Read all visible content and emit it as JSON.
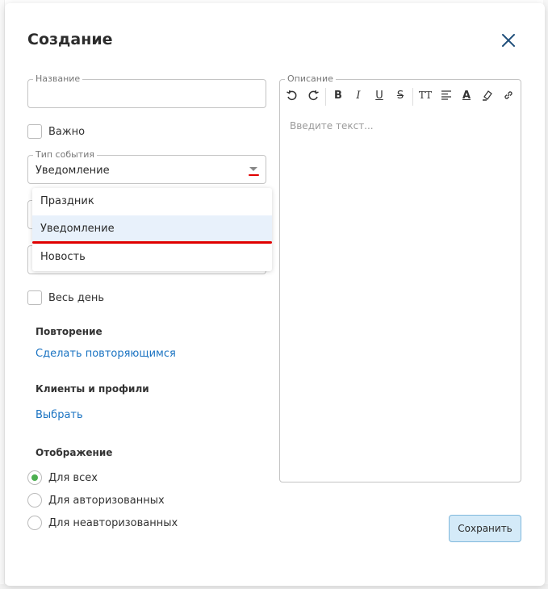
{
  "dialog": {
    "title": "Создание",
    "save_label": "Сохранить"
  },
  "form": {
    "name_legend": "Название",
    "name_value": "",
    "important_label": "Важно",
    "event_type_legend": "Тип события",
    "event_type_value": "Уведомление",
    "event_type_options": [
      "Праздник",
      "Уведомление",
      "Новость"
    ],
    "all_day_label": "Весь день",
    "repeat_title": "Повторение",
    "repeat_link": "Сделать повторяющимся",
    "clients_title": "Клиенты и профили",
    "clients_link": "Выбрать",
    "display_title": "Отображение",
    "display_options": [
      "Для всех",
      "Для авторизованных",
      "Для неавторизованных"
    ],
    "display_selected": "Для всех"
  },
  "editor": {
    "legend": "Описание",
    "placeholder": "Введите текст...",
    "toolbar": {
      "bold": "B",
      "italic": "I",
      "underline": "U",
      "strike": "S",
      "text_size": "TT",
      "text_color": "A"
    }
  },
  "colors": {
    "accent": "#1a73c2",
    "radio_checked": "#4caf50",
    "highlight": "#e00000",
    "selected_item_bg": "#e8f1fb",
    "save_bg": "#d4eaf8"
  }
}
